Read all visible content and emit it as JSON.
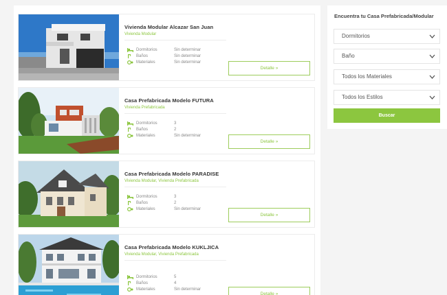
{
  "listings": [
    {
      "title": "Vivienda Modular Alcazar San Juan",
      "category": "Vivienda Modular",
      "attributes": [
        {
          "label": "Dormitorios",
          "value": "Sin determinar",
          "icon": "bed-icon"
        },
        {
          "label": "Baños",
          "value": "Sin determinar",
          "icon": "bath-icon"
        },
        {
          "label": "Materiales",
          "value": "Sin determinar",
          "icon": "materials-icon"
        }
      ],
      "button_label": "Detalle »"
    },
    {
      "title": "Casa Prefabricada Modelo FUTURA",
      "category": "Vivienda Prefabricada",
      "attributes": [
        {
          "label": "Dormitorios",
          "value": "3",
          "icon": "bed-icon"
        },
        {
          "label": "Baños",
          "value": "2",
          "icon": "bath-icon"
        },
        {
          "label": "Materiales",
          "value": "Sin determinar",
          "icon": "materials-icon"
        }
      ],
      "button_label": "Detalle »"
    },
    {
      "title": "Casa Prefabricada Modelo PARADISE",
      "category": "Vivienda Modular, Vivienda Prefabricada",
      "attributes": [
        {
          "label": "Dormitorios",
          "value": "3",
          "icon": "bed-icon"
        },
        {
          "label": "Baños",
          "value": "2",
          "icon": "bath-icon"
        },
        {
          "label": "Materiales",
          "value": "Sin determinar",
          "icon": "materials-icon"
        }
      ],
      "button_label": "Detalle »"
    },
    {
      "title": "Casa Prefabricada Modelo KUKLJICA",
      "category": "Vivienda Modular, Vivienda Prefabricada",
      "attributes": [
        {
          "label": "Dormitorios",
          "value": "5",
          "icon": "bed-icon"
        },
        {
          "label": "Baños",
          "value": "4",
          "icon": "bath-icon"
        },
        {
          "label": "Materiales",
          "value": "Sin determinar",
          "icon": "materials-icon"
        }
      ],
      "button_label": "Detalle »"
    }
  ],
  "sidebar": {
    "heading": "Encuentra tu Casa Prefabricada/Modular",
    "filters": [
      {
        "label": "Dormitorios"
      },
      {
        "label": "Baño"
      },
      {
        "label": "Todos los Materiales"
      },
      {
        "label": "Todos los Estilos"
      }
    ],
    "search_label": "Buscar"
  },
  "colors": {
    "accent": "#8cc63f",
    "text": "#333333",
    "muted": "#888888",
    "background": "#f4f4f4"
  }
}
